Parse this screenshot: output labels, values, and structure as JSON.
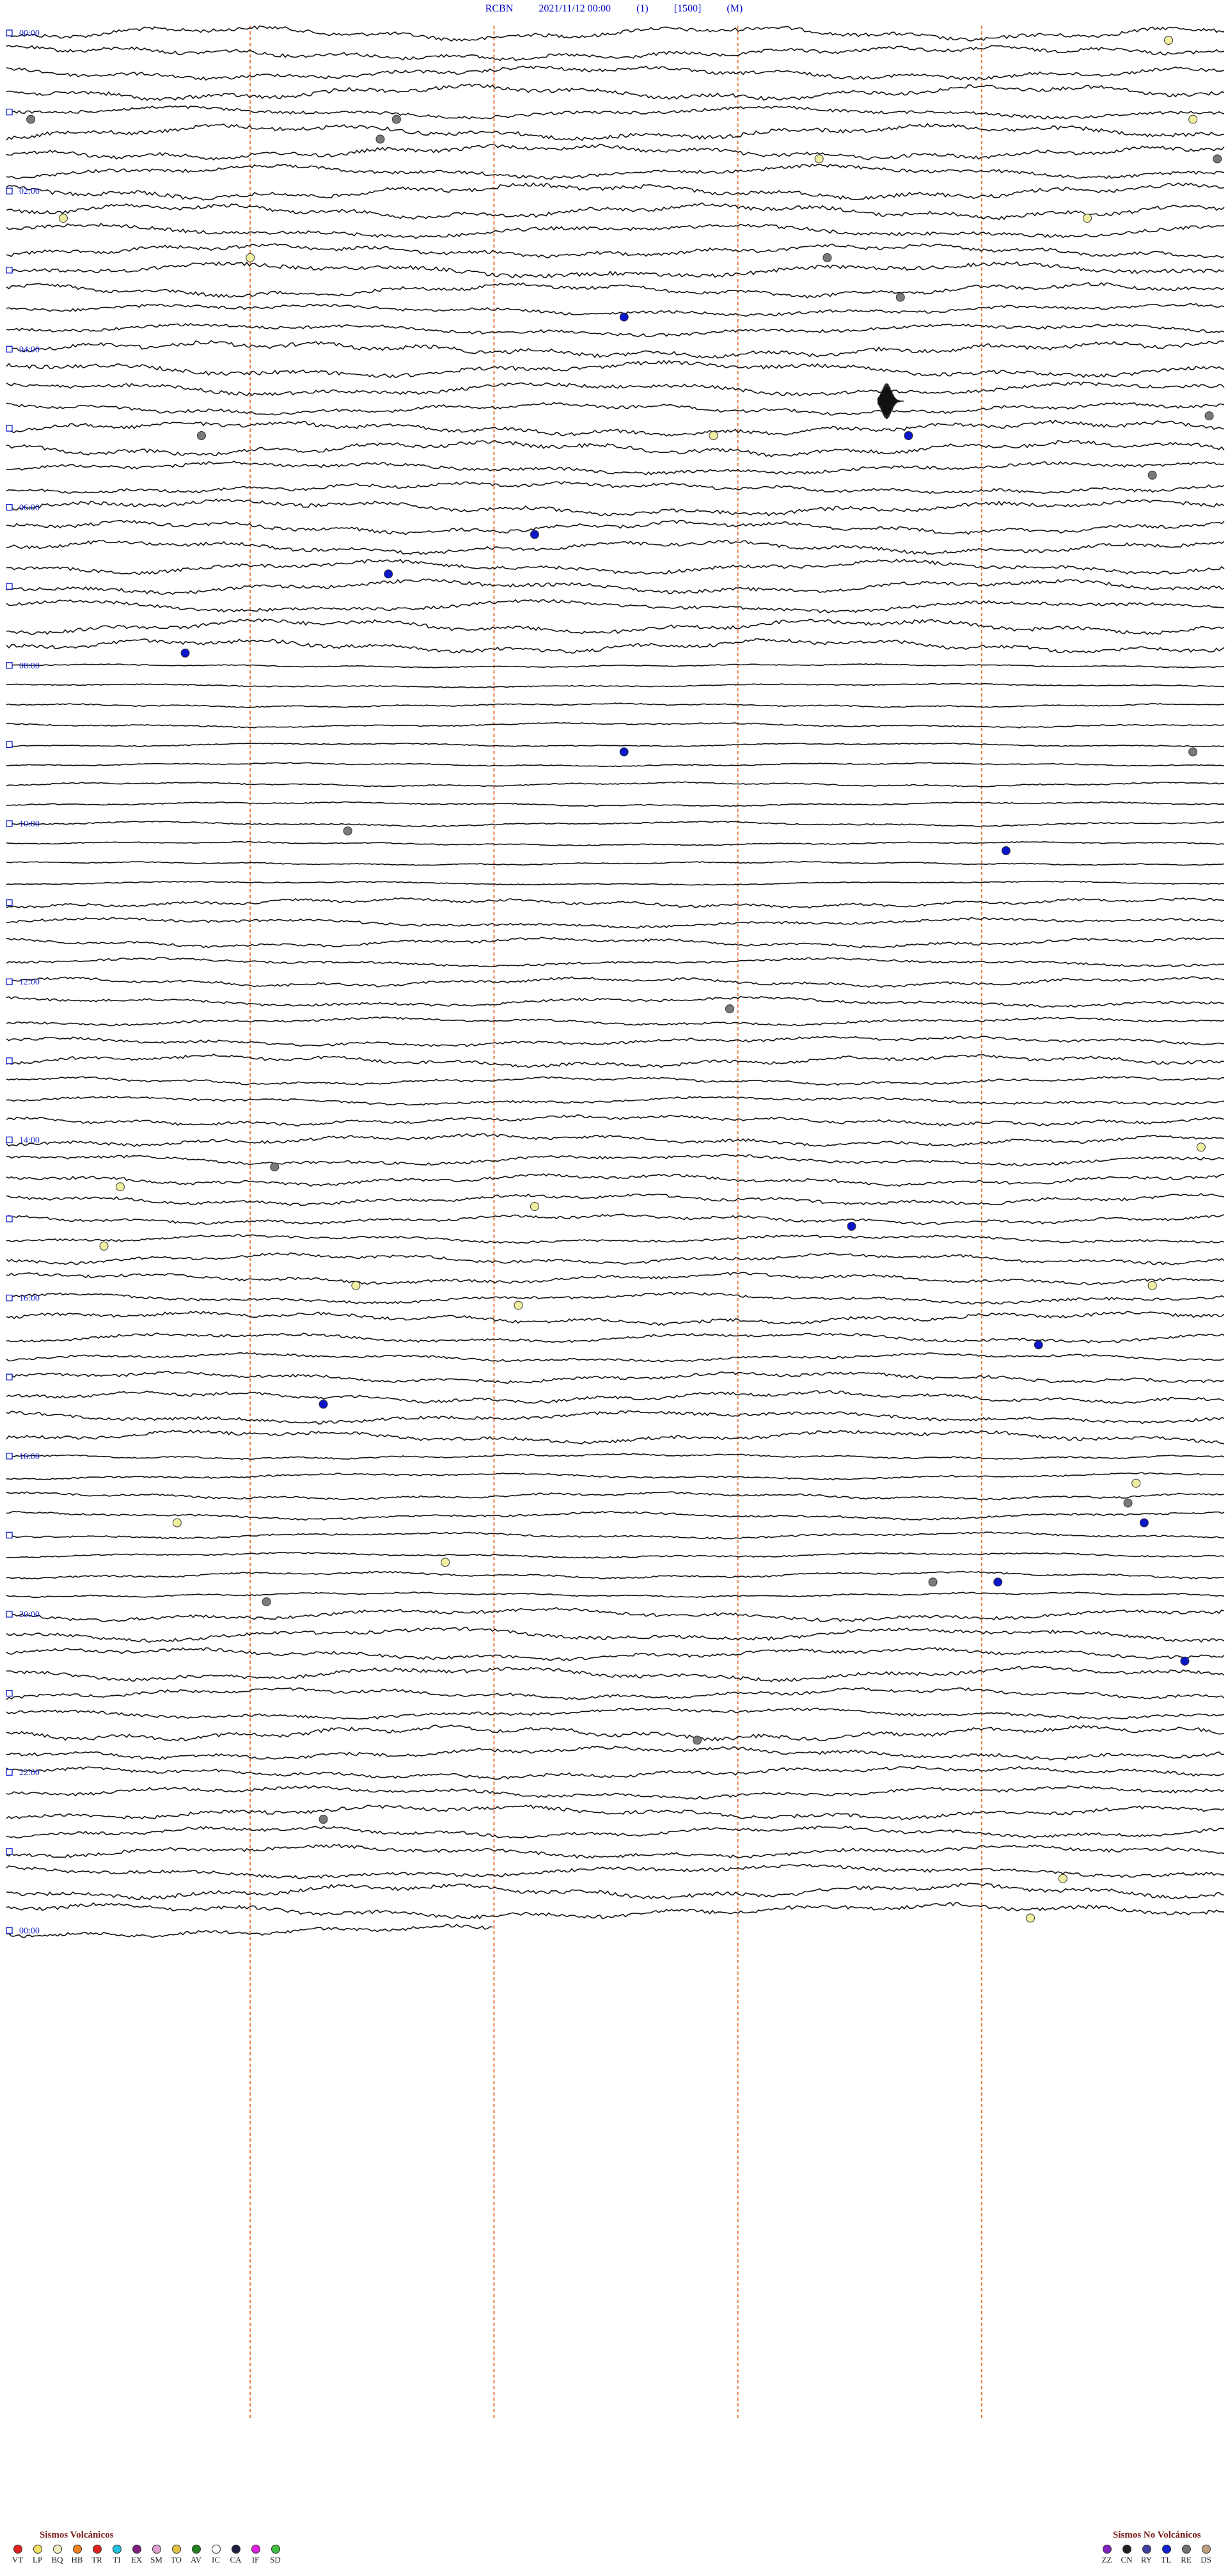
{
  "header": {
    "station": "RCBN",
    "datetime": "2021/11/12 00:00",
    "channel": "(1)",
    "gain": "[1500]",
    "mode": "(M)"
  },
  "chart_data": {
    "type": "helicorder",
    "minutes_per_line": 15,
    "lines_total": 96,
    "lines_drawn": 97,
    "hour_labels": [
      "00:00",
      "02:00",
      "04:00",
      "06:00",
      "08:00",
      "10:00",
      "12:00",
      "14:00",
      "16:00",
      "18:00",
      "20:00",
      "22:00",
      "00:00"
    ],
    "minute_markers": [
      3,
      6,
      9,
      12
    ],
    "event_colors": {
      "yellow": "#f0eea0",
      "gray": "#7a7a7a",
      "blue": "#0a16c8"
    },
    "events": [
      {
        "line": 0,
        "minute": 14.3,
        "type": "yellow"
      },
      {
        "line": 4,
        "minute": 0.3,
        "type": "gray"
      },
      {
        "line": 4,
        "minute": 4.8,
        "type": "gray"
      },
      {
        "line": 4,
        "minute": 14.6,
        "type": "yellow"
      },
      {
        "line": 5,
        "minute": 4.6,
        "type": "gray"
      },
      {
        "line": 6,
        "minute": 10.0,
        "type": "yellow"
      },
      {
        "line": 6,
        "minute": 14.9,
        "type": "gray"
      },
      {
        "line": 9,
        "minute": 0.7,
        "type": "yellow"
      },
      {
        "line": 9,
        "minute": 13.3,
        "type": "yellow"
      },
      {
        "line": 11,
        "minute": 3.0,
        "type": "yellow"
      },
      {
        "line": 11,
        "minute": 10.1,
        "type": "gray"
      },
      {
        "line": 13,
        "minute": 11.0,
        "type": "gray"
      },
      {
        "line": 14,
        "minute": 7.6,
        "type": "blue"
      },
      {
        "line": 19,
        "minute": 14.8,
        "type": "gray"
      },
      {
        "line": 20,
        "minute": 8.7,
        "type": "yellow"
      },
      {
        "line": 20,
        "minute": 2.4,
        "type": "gray"
      },
      {
        "line": 20,
        "minute": 11.1,
        "type": "blue"
      },
      {
        "line": 22,
        "minute": 14.1,
        "type": "gray"
      },
      {
        "line": 25,
        "minute": 6.5,
        "type": "blue"
      },
      {
        "line": 27,
        "minute": 4.7,
        "type": "blue"
      },
      {
        "line": 31,
        "minute": 2.2,
        "type": "blue"
      },
      {
        "line": 36,
        "minute": 7.6,
        "type": "blue"
      },
      {
        "line": 36,
        "minute": 14.6,
        "type": "gray"
      },
      {
        "line": 40,
        "minute": 4.2,
        "type": "gray"
      },
      {
        "line": 41,
        "minute": 12.3,
        "type": "blue"
      },
      {
        "line": 49,
        "minute": 8.9,
        "type": "gray"
      },
      {
        "line": 56,
        "minute": 14.7,
        "type": "yellow"
      },
      {
        "line": 57,
        "minute": 3.3,
        "type": "gray"
      },
      {
        "line": 58,
        "minute": 1.4,
        "type": "yellow"
      },
      {
        "line": 59,
        "minute": 6.5,
        "type": "yellow"
      },
      {
        "line": 60,
        "minute": 10.4,
        "type": "blue"
      },
      {
        "line": 61,
        "minute": 1.2,
        "type": "yellow"
      },
      {
        "line": 63,
        "minute": 4.3,
        "type": "yellow"
      },
      {
        "line": 63,
        "minute": 14.1,
        "type": "yellow"
      },
      {
        "line": 64,
        "minute": 6.3,
        "type": "yellow"
      },
      {
        "line": 66,
        "minute": 12.7,
        "type": "blue"
      },
      {
        "line": 69,
        "minute": 3.9,
        "type": "blue"
      },
      {
        "line": 73,
        "minute": 13.9,
        "type": "yellow"
      },
      {
        "line": 74,
        "minute": 13.8,
        "type": "gray"
      },
      {
        "line": 75,
        "minute": 14.0,
        "type": "blue"
      },
      {
        "line": 75,
        "minute": 2.1,
        "type": "yellow"
      },
      {
        "line": 77,
        "minute": 5.4,
        "type": "yellow"
      },
      {
        "line": 78,
        "minute": 11.4,
        "type": "gray"
      },
      {
        "line": 78,
        "minute": 12.2,
        "type": "blue"
      },
      {
        "line": 79,
        "minute": 3.2,
        "type": "gray"
      },
      {
        "line": 82,
        "minute": 14.5,
        "type": "blue"
      },
      {
        "line": 86,
        "minute": 8.5,
        "type": "gray"
      },
      {
        "line": 90,
        "minute": 3.9,
        "type": "gray"
      },
      {
        "line": 93,
        "minute": 13.0,
        "type": "yellow"
      },
      {
        "line": 95,
        "minute": 12.6,
        "type": "yellow"
      }
    ]
  },
  "legend_volcanic": {
    "title": "Sismos Volcánicos",
    "items": [
      {
        "code": "VT",
        "color": "#e02020"
      },
      {
        "code": "LP",
        "color": "#f0e060"
      },
      {
        "code": "BQ",
        "color": "#f0ecc0"
      },
      {
        "code": "HB",
        "color": "#f08020"
      },
      {
        "code": "TR",
        "color": "#e02020"
      },
      {
        "code": "TI",
        "color": "#20c0e0"
      },
      {
        "code": "EX",
        "color": "#802080"
      },
      {
        "code": "SM",
        "color": "#e0a0d0"
      },
      {
        "code": "TO",
        "color": "#e0c040"
      },
      {
        "code": "AV",
        "color": "#208020"
      },
      {
        "code": "IC",
        "color": "#ffffff"
      },
      {
        "code": "CA",
        "color": "#202040"
      },
      {
        "code": "IF",
        "color": "#e020e0"
      },
      {
        "code": "SD",
        "color": "#40c040"
      }
    ]
  },
  "legend_nonvolcanic": {
    "title": "Sismos No Volcánicos",
    "items": [
      {
        "code": "ZZ",
        "color": "#8020c0"
      },
      {
        "code": "CN",
        "color": "#202020"
      },
      {
        "code": "RY",
        "color": "#4040a0"
      },
      {
        "code": "TL",
        "color": "#1020d0"
      },
      {
        "code": "RE",
        "color": "#707070"
      },
      {
        "code": "DS",
        "color": "#c0a080"
      }
    ]
  }
}
